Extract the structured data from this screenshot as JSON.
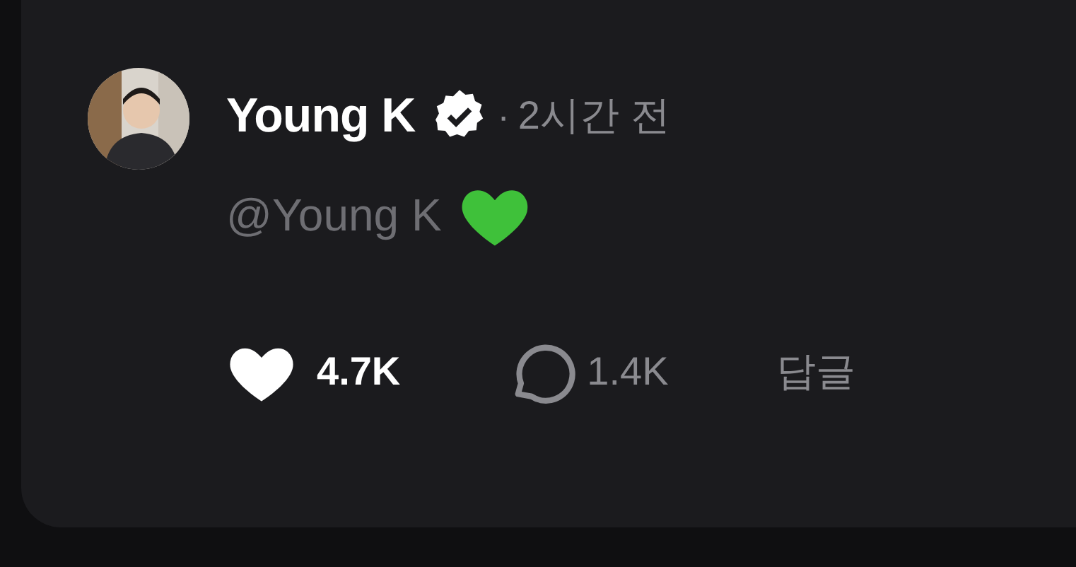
{
  "post": {
    "author": "Young K",
    "verified": true,
    "separator": "·",
    "time": "2시간 전",
    "text": "@Young K"
  },
  "actions": {
    "liked": true,
    "likes": "4.7K",
    "comments": "1.4K",
    "reply": "답글"
  }
}
